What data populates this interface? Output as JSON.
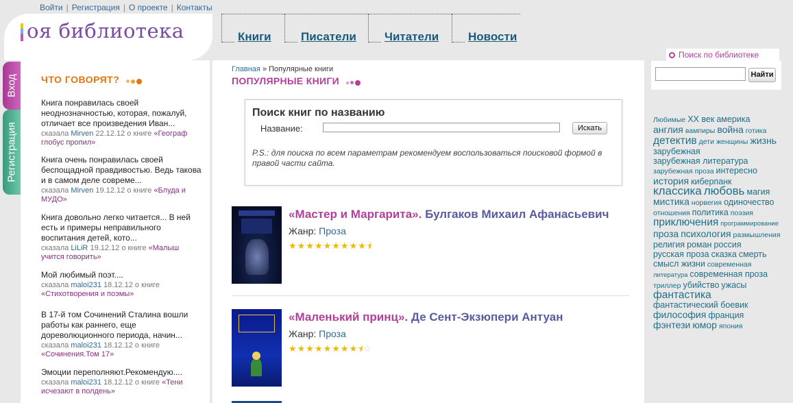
{
  "top_links": [
    "Войти",
    "Регистрация",
    "О проекте",
    "Контакты"
  ],
  "logo": {
    "text": "оя библиотека"
  },
  "nav": [
    "Книги",
    "Писатели",
    "Читатели",
    "Новости"
  ],
  "side_tabs": {
    "login": "Вход",
    "register": "Регистрация"
  },
  "sidebar": {
    "title": "ЧТО ГОВОРЯТ?",
    "comments": [
      {
        "text": "Книга понравилась своей неоднозначностью, которая, пожалуй, отличает все произведения Иван...",
        "said": "сказала",
        "user": "Mirven",
        "date": "22.12.12",
        "about": "о книге",
        "book": "«Географ глобус пропил»"
      },
      {
        "text": "Книга очень понравилась своей беспощадной правдивостью. Ведь такова и в самом деле совреме...",
        "said": "сказала",
        "user": "Mirven",
        "date": "19.12.12",
        "about": "о книге",
        "book": "«Блуда и МУДО»"
      },
      {
        "text": "Книга довольно легко читается... В ней есть и примеры неправильного воспитания детей, кото...",
        "said": "сказала",
        "user": "LiLiR",
        "date": "19.12.12",
        "about": "о книге",
        "book": "«Малыш учится говорить»"
      },
      {
        "text": "Мой любимый поэт....",
        "said": "сказала",
        "user": "maloi231",
        "date": "18.12.12",
        "about": "о книге",
        "book": "«Стихотворения и поэмы»"
      },
      {
        "text": "В 17-й том Сочинений Сталина вошли работы как раннего, еще дореволюционного периода, начин...",
        "said": "сказала",
        "user": "maloi231",
        "date": "18.12.12",
        "about": "о книге",
        "book": "«Сочинения.Том 17»"
      },
      {
        "text": "Эмоции переполняют.Рекомендую....",
        "said": "сказала",
        "user": "maloi231",
        "date": "18.12.12",
        "about": "о книге",
        "book": "«Тени исчезают в полдень»"
      }
    ]
  },
  "breadcrumb": {
    "home": "Главная",
    "sep": "»",
    "current": "Популярные книги"
  },
  "page_title": "ПОПУЛЯРНЫЕ КНИГИ",
  "title_search": {
    "heading": "Поиск книг по названию",
    "label": "Название:",
    "value": "",
    "button": "Искать",
    "note": "P.S.: для поиска по всем параметрам рекомендуем воспользоваться поисковой формой в правой части сайта."
  },
  "books": [
    {
      "title": "«Мастер и Маргарита».",
      "author": "Булгаков Михаил Афанасьевич",
      "genre_label": "Жанр:",
      "genre": "Проза",
      "rating": 9.5,
      "max_rating": 10,
      "stars": "★★★★★★★★★",
      "half": "⯨",
      "empty": ""
    },
    {
      "title": "«Маленький принц».",
      "author": "Де Сент-Экзюпери Антуан",
      "genre_label": "Жанр:",
      "genre": "Проза",
      "rating": 8.5,
      "max_rating": 10,
      "stars": "★★★★★★★★",
      "half": "⯨",
      "empty": "☆"
    }
  ],
  "right_search": {
    "title": "Поиск по библиотеке",
    "value": "",
    "button": "Найти"
  },
  "tags": [
    {
      "t": "Любимые",
      "s": 1
    },
    {
      "t": "XX век",
      "s": 2
    },
    {
      "t": "америка",
      "s": 2
    },
    {
      "t": "англия",
      "s": 3
    },
    {
      "t": "вампиры",
      "s": 1
    },
    {
      "t": "война",
      "s": 3
    },
    {
      "t": "готика",
      "s": 1
    },
    {
      "t": "детектив",
      "s": 4
    },
    {
      "t": "дети",
      "s": 1
    },
    {
      "t": "женщины",
      "s": 1
    },
    {
      "t": "жизнь",
      "s": 3
    },
    {
      "t": "зарубежная",
      "s": 2
    },
    {
      "t": "зарубежная литература",
      "s": 2
    },
    {
      "t": "зарубежная проза",
      "s": 1
    },
    {
      "t": "интересно",
      "s": 2
    },
    {
      "t": "история",
      "s": 3
    },
    {
      "t": "киберпанк",
      "s": 2
    },
    {
      "t": "классика",
      "s": 5
    },
    {
      "t": "любовь",
      "s": 5
    },
    {
      "t": "магия",
      "s": 2
    },
    {
      "t": "мистика",
      "s": 3
    },
    {
      "t": "норвегия",
      "s": 1
    },
    {
      "t": "одиночество",
      "s": 2
    },
    {
      "t": "отношения",
      "s": 1
    },
    {
      "t": "политика",
      "s": 2
    },
    {
      "t": "поэзия",
      "s": 1
    },
    {
      "t": "приключения",
      "s": 4
    },
    {
      "t": "программирование",
      "s": 0
    },
    {
      "t": "проза",
      "s": 3
    },
    {
      "t": "психология",
      "s": 3
    },
    {
      "t": "размышления",
      "s": 1
    },
    {
      "t": "религия",
      "s": 2
    },
    {
      "t": "роман",
      "s": 2
    },
    {
      "t": "россия",
      "s": 2
    },
    {
      "t": "русская проза",
      "s": 2
    },
    {
      "t": "сказка",
      "s": 2
    },
    {
      "t": "смерть",
      "s": 2
    },
    {
      "t": "смысл жизни",
      "s": 2
    },
    {
      "t": "современная",
      "s": 1
    },
    {
      "t": "литература",
      "s": 0
    },
    {
      "t": "современная проза",
      "s": 2
    },
    {
      "t": "триллер",
      "s": 1
    },
    {
      "t": "убийство",
      "s": 2
    },
    {
      "t": "ужасы",
      "s": 2
    },
    {
      "t": "фантастика",
      "s": 4
    },
    {
      "t": "фантастический боевик",
      "s": 2
    },
    {
      "t": "философия",
      "s": 3
    },
    {
      "t": "франция",
      "s": 2
    },
    {
      "t": "фэнтези",
      "s": 3
    },
    {
      "t": "юмор",
      "s": 3
    },
    {
      "t": "япония",
      "s": 1
    }
  ],
  "colors": {
    "accent_pink": "#b2409a",
    "accent_orange": "#e2750e",
    "link_teal": "#1f6e88",
    "tab_pink": "#b84aa5",
    "tab_green": "#4aaa8c"
  }
}
